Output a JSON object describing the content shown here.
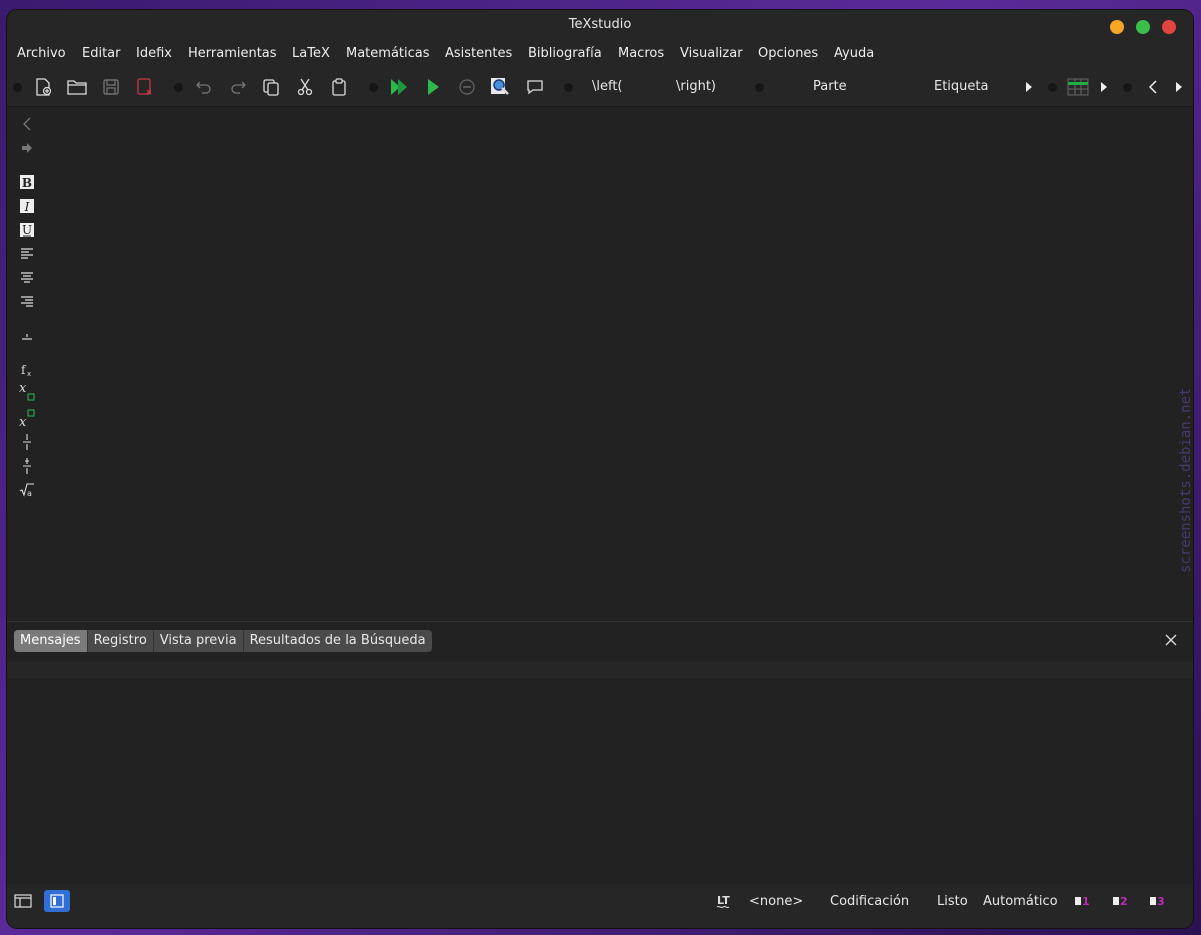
{
  "window": {
    "title": "TeXstudio",
    "controls": [
      "minimize",
      "maximize",
      "close"
    ],
    "colors": {
      "minimize": "#f5a623",
      "maximize": "#3bbf4a",
      "close": "#e0463f"
    }
  },
  "menu": [
    "Archivo",
    "Editar",
    "Idefix",
    "Herramientas",
    "LaTeX",
    "Matemáticas",
    "Asistentes",
    "Bibliografía",
    "Macros",
    "Visualizar",
    "Opciones",
    "Ayuda"
  ],
  "toolbar": {
    "left_bracket": "\\left(",
    "right_bracket": "\\right)",
    "part_combo": "Parte",
    "label_combo": "Etiqueta"
  },
  "panel": {
    "tabs": [
      "Mensajes",
      "Registro",
      "Vista previa",
      "Resultados de la Búsqueda"
    ],
    "active_tab": "Mensajes"
  },
  "status": {
    "language": "<none>",
    "encoding": "Codificación",
    "state": "Listo",
    "mode": "Automático",
    "bookmarks": [
      "1",
      "2",
      "3"
    ]
  },
  "watermark": "screenshots.debian.net"
}
